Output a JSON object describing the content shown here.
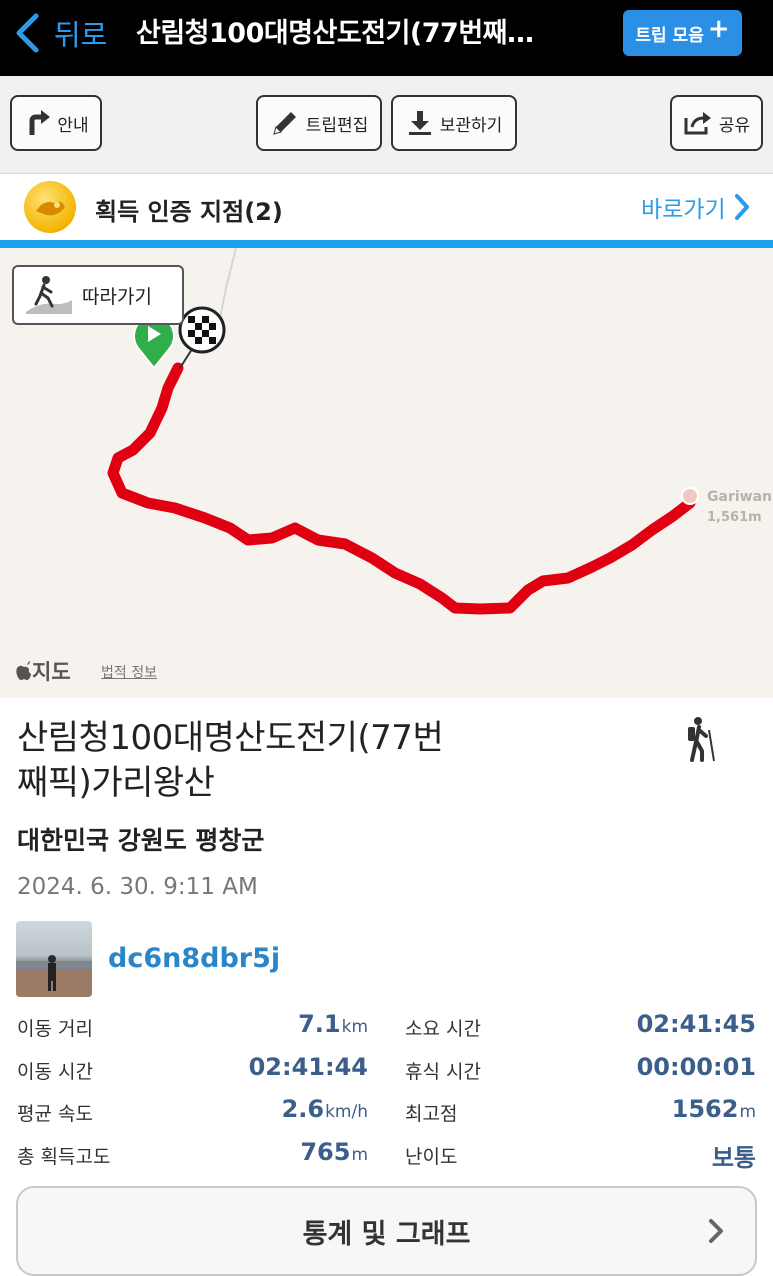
{
  "nav": {
    "back_label": "뒤로",
    "title": "산림청100대명산도전기(77번째…",
    "trip_collection_label": "트립 모음"
  },
  "toolbar": {
    "guide_label": "안내",
    "edit_label": "트립편집",
    "save_label": "보관하기",
    "share_label": "공유"
  },
  "certification": {
    "label": "획득 인증 지점(2)",
    "link_label": "바로가기"
  },
  "map": {
    "follow_label": "따라가기",
    "peak_name": "Gariwan",
    "peak_elevation": "1,561m",
    "provider": "지도",
    "legal_label": "법적 정보",
    "route_color": "#e00012"
  },
  "trip": {
    "title": "산림청100대명산도전기(77번째픽)가리왕산",
    "region": "대한민국 강원도 평창군",
    "date": "2024. 6. 30. 9:11 AM",
    "username": "dc6n8dbr5j"
  },
  "stats": {
    "distance_label": "이동 거리",
    "distance_value": "7.1",
    "distance_unit": "km",
    "elapsed_label": "소요 시간",
    "elapsed_value": "02:41:45",
    "moving_label": "이동 시간",
    "moving_value": "02:41:44",
    "rest_label": "휴식 시간",
    "rest_value": "00:00:01",
    "speed_label": "평균 속도",
    "speed_value": "2.6",
    "speed_unit": "km/h",
    "max_alt_label": "최고점",
    "max_alt_value": "1562",
    "max_alt_unit": "m",
    "gain_label": "총 획득고도",
    "gain_value": "765",
    "gain_unit": "m",
    "difficulty_label": "난이도",
    "difficulty_value": "보통"
  },
  "stats_button_label": "통계 및 그래프",
  "colors": {
    "accent": "#2e9bea",
    "stat_value": "#3b5f8a",
    "route": "#e00012"
  }
}
